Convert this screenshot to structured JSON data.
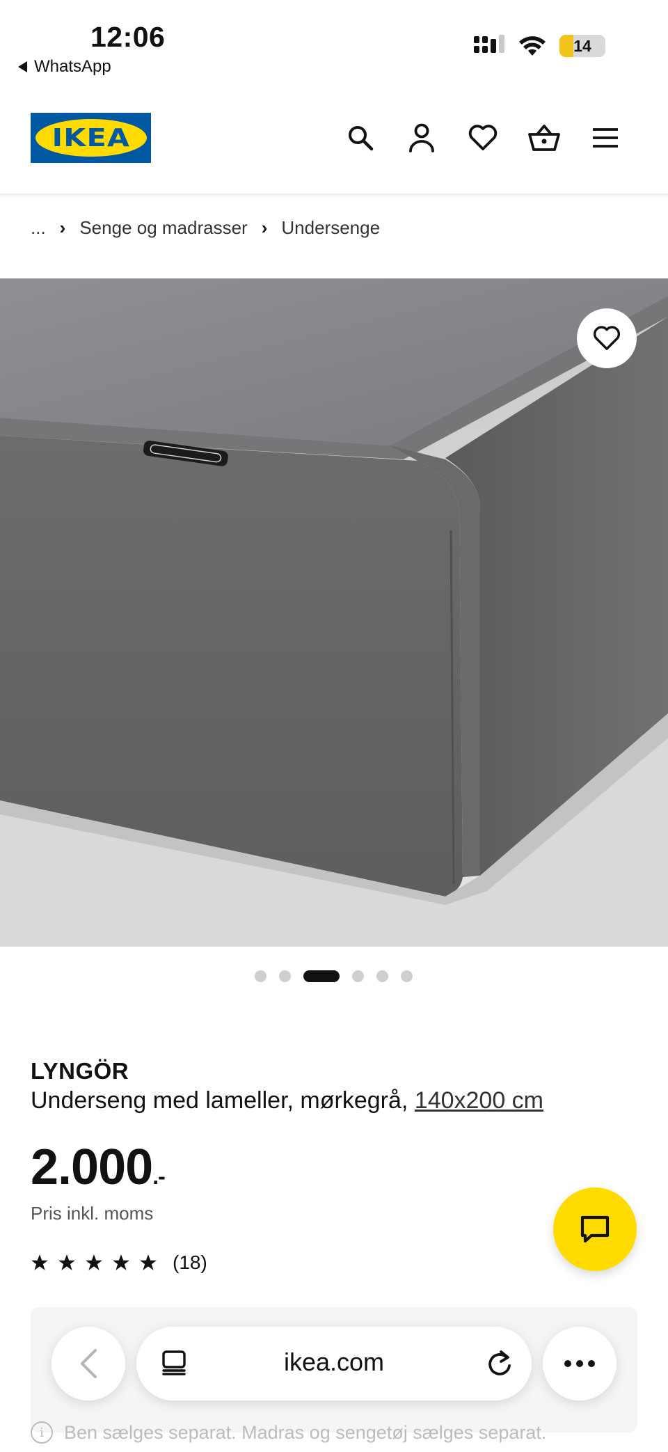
{
  "status_bar": {
    "time": "12:06",
    "back_app": "WhatsApp",
    "battery": "14"
  },
  "header": {
    "logo_text": "IKEA",
    "icons": [
      "search-icon",
      "profile-icon",
      "favorites-icon",
      "basket-icon",
      "menu-icon"
    ]
  },
  "breadcrumb": {
    "ellipsis": "...",
    "items": [
      "Senge og madrasser",
      "Undersenge"
    ]
  },
  "gallery": {
    "dot_count": 6,
    "active_index": 2
  },
  "product": {
    "name": "LYNGÖR",
    "description": "Underseng med lameller, mørkegrå,",
    "size_link": "140x200 cm",
    "price": "2.000",
    "price_suffix": ".-",
    "price_note": "Pris inkl. moms",
    "rating": 5,
    "rating_count": "(18)"
  },
  "notice": {
    "text": "Ben sælges separat. Madras og sengetøj sælges separat."
  },
  "browser": {
    "url": "ikea.com"
  },
  "colors": {
    "ikea_blue": "#0058a3",
    "ikea_yellow": "#ffdb00",
    "battery_low": "#f2c31a"
  }
}
